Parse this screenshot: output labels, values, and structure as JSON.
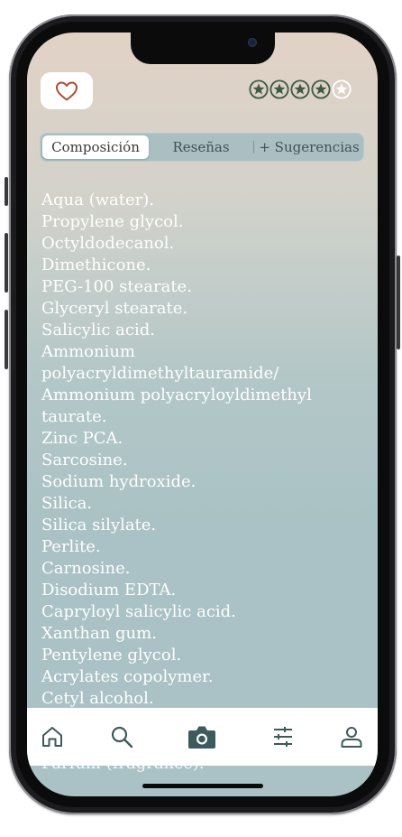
{
  "header": {
    "favorite_icon": "heart-outline-icon",
    "rating": 4,
    "rating_max": 5,
    "star_color": "#3f5a44"
  },
  "tabs": [
    {
      "label": "Composición",
      "active": true
    },
    {
      "label": "Reseñas",
      "active": false
    },
    {
      "label": "+ Sugerencias",
      "active": false
    }
  ],
  "ingredients": [
    "Aqua (water).",
    "Propylene glycol.",
    "Octyldodecanol.",
    "Dimethicone.",
    "PEG-100 stearate.",
    "Glyceryl stearate.",
    "Salicylic acid.",
    "Ammonium",
    "polyacryldimethyltauramide/",
    "Ammonium polyacryloyldimethyl",
    "taurate.",
    "Zinc PCA.",
    "Sarcosine.",
    "Sodium hydroxide.",
    "Silica.",
    "Silica silylate.",
    "Perlite.",
    "Carnosine.",
    "Disodium EDTA.",
    "Capryloyl salicylic acid.",
    "Xanthan gum.",
    "Pentylene glycol.",
    "Acrylates copolymer.",
    "Cetyl alcohol."
  ],
  "ingredients_overflow": "Parfum (fragrance).",
  "tabbar": {
    "items": [
      {
        "icon": "home-icon"
      },
      {
        "icon": "search-icon"
      },
      {
        "icon": "camera-icon"
      },
      {
        "icon": "filters-icon"
      },
      {
        "icon": "profile-icon"
      }
    ],
    "accent": "#3d5a5c"
  }
}
